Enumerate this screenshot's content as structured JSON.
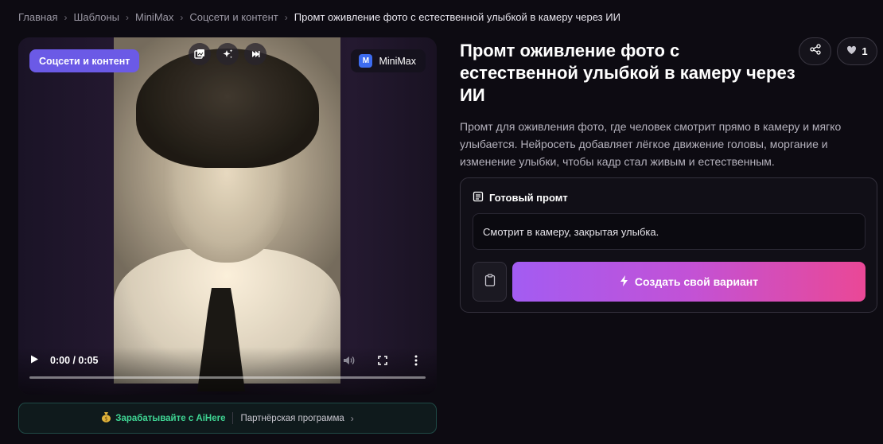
{
  "breadcrumb": {
    "items": [
      "Главная",
      "Шаблоны",
      "MiniMax",
      "Соцсети и контент"
    ],
    "current": "Промт оживление фото с естественной улыбкой в камеру через ИИ"
  },
  "media": {
    "category_chip": "Соцсети и контент",
    "model_logo_letter": "M",
    "model_name": "MiniMax",
    "tools": [
      "gallery-icon",
      "sparkles-icon",
      "skip-forward-icon"
    ],
    "player": {
      "time": "0:00 / 0:05",
      "progress": 0
    }
  },
  "partner": {
    "earn_label": "Зарабатывайте с AiHere",
    "program_label": "Партнёрская программа"
  },
  "page": {
    "title": "Промт оживление фото с естественной улыбкой в камеру через ИИ",
    "like_count": "1",
    "description": "Промт для оживления фото, где человек смотрит прямо в камеру и мягко улыбается. Нейросеть добавляет лёгкое движение головы, моргание и изменение улыбки, чтобы кадр стал живым и естественным."
  },
  "prompt": {
    "heading": "Готовый промт",
    "text": "Смотрит в камеру, закрытая улыбка.",
    "create_label": "Создать свой вариант"
  },
  "colors": {
    "background": "#0d0b12",
    "category_chip": "#6b5ae6",
    "partner_accent": "#3fd694",
    "cta_gradient_start": "#a35cf2",
    "cta_gradient_end": "#ea4896"
  }
}
